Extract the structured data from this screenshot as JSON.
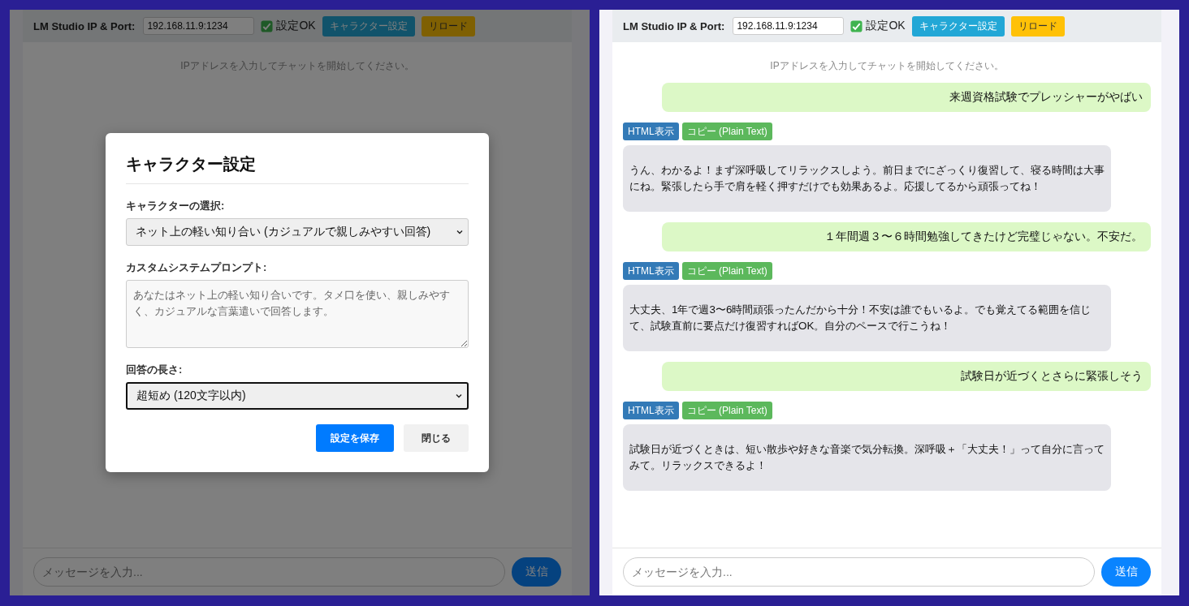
{
  "panes": [
    {
      "header": {
        "label": "LM Studio IP & Port:",
        "address": "192.168.11.9:1234",
        "status": "設定OK",
        "buttons": [
          {
            "kind": "settings",
            "label": "キャラクター設定"
          },
          {
            "kind": "reload",
            "label": "リロード"
          }
        ]
      },
      "hint": "IPアドレスを入力してチャットを開始してください。",
      "composer": {
        "placeholder": "メッセージを入力...",
        "send": "送信"
      },
      "modal": {
        "title": "キャラクター設定",
        "fields": [
          {
            "kind": "select",
            "label": "キャラクターの選択:",
            "value": "ネット上の軽い知り合い (カジュアルで親しみやすい回答)",
            "focused": false
          },
          {
            "kind": "textarea",
            "label": "カスタムシステムプロンプト:",
            "placeholder": "あなたはネット上の軽い知り合いです。タメ口を使い、親しみやすく、カジュアルな言葉遣いで回答します。"
          },
          {
            "kind": "select",
            "label": "回答の長さ:",
            "value": "超短め (120文字以内)",
            "focused": true
          }
        ],
        "buttons": [
          {
            "kind": "primary",
            "label": "設定を保存"
          },
          {
            "kind": "secondary",
            "label": "閉じる"
          }
        ]
      }
    },
    {
      "header": {
        "label": "LM Studio IP & Port:",
        "address": "192.168.11.9:1234",
        "status": "設定OK",
        "buttons": [
          {
            "kind": "settings",
            "label": "キャラクター設定"
          },
          {
            "kind": "reload",
            "label": "リロード"
          }
        ]
      },
      "hint": "IPアドレスを入力してチャットを開始してください。",
      "messages": [
        {
          "kind": "user",
          "text": "来週資格試験でプレッシャーがやばい"
        },
        {
          "kind": "bot",
          "actions": [
            "HTML表示",
            "コピー (Plain Text)"
          ],
          "text": "うん、わかるよ！まず深呼吸してリラックスしよう。前日までにざっくり復習して、寝る時間は大事にね。緊張したら手で肩を軽く押すだけでも効果あるよ。応援してるから頑張ってね！"
        },
        {
          "kind": "user",
          "text": "１年間週３〜６時間勉強してきたけど完璧じゃない。不安だ。"
        },
        {
          "kind": "bot",
          "actions": [
            "HTML表示",
            "コピー (Plain Text)"
          ],
          "text": "大丈夫、1年で週3〜6時間頑張ったんだから十分！不安は誰でもいるよ。でも覚えてる範囲を信じて、試験直前に要点だけ復習すればOK。自分のペースで行こうね！"
        },
        {
          "kind": "user",
          "text": "試験日が近づくとさらに緊張しそう"
        },
        {
          "kind": "bot",
          "actions": [
            "HTML表示",
            "コピー (Plain Text)"
          ],
          "text": "試験日が近づくときは、短い散歩や好きな音楽で気分転換。深呼吸＋「大丈夫！」って自分に言ってみて。リラックスできるよ！"
        }
      ],
      "composer": {
        "placeholder": "メッセージを入力...",
        "send": "送信"
      }
    }
  ]
}
